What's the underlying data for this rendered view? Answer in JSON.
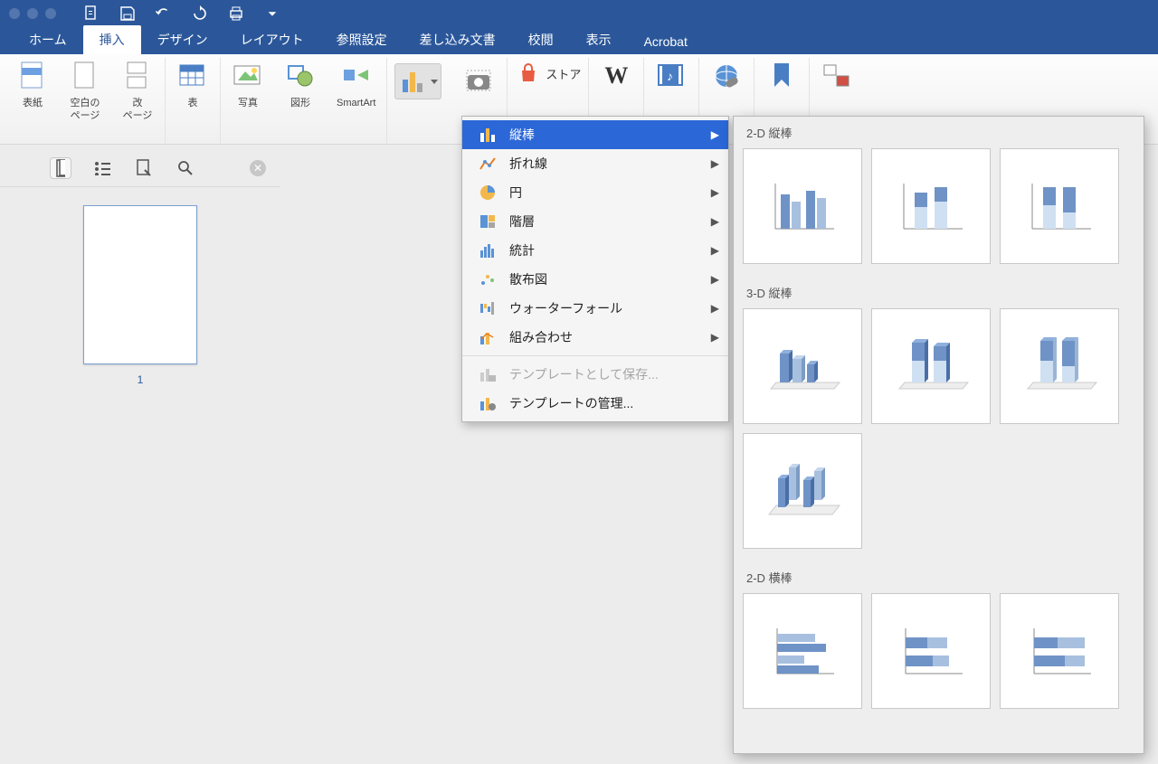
{
  "tabs": {
    "home": "ホーム",
    "insert": "挿入",
    "design": "デザイン",
    "layout": "レイアウト",
    "reference": "参照設定",
    "mailings": "差し込み文書",
    "review": "校閲",
    "view": "表示",
    "acrobat": "Acrobat"
  },
  "ribbon": {
    "cover": "表紙",
    "blank_page": "空白の\nページ",
    "page_break": "改\nページ",
    "table": "表",
    "photo": "写真",
    "shapes": "図形",
    "smartart": "SmartArt",
    "store": "ストア"
  },
  "chart_menu": {
    "column": "縦棒",
    "line": "折れ線",
    "pie": "円",
    "bar_hier": "階層",
    "stats": "統計",
    "scatter": "散布図",
    "waterfall": "ウォーターフォール",
    "combo": "組み合わせ",
    "save_template": "テンプレートとして保存...",
    "manage_template": "テンプレートの管理..."
  },
  "gallery": {
    "h_2d_col": "2-D 縦棒",
    "h_3d_col": "3-D 縦棒",
    "h_2d_bar": "2-D 横棒"
  },
  "thumb_page": "1"
}
